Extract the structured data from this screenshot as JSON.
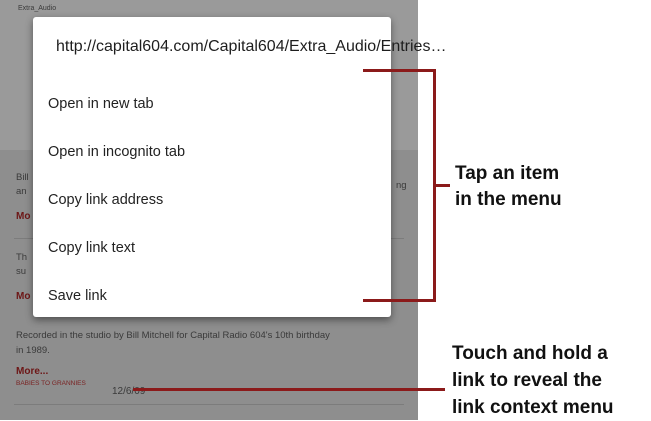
{
  "background": {
    "header_snippet": "Extra_Audio",
    "date": "12/6/09",
    "lines": [
      {
        "text": "Bill"
      },
      {
        "text": "an"
      },
      {
        "text": "ng"
      },
      {
        "text": "Mo"
      },
      {
        "text": "Th"
      },
      {
        "text": "su"
      },
      {
        "text": "Mo"
      }
    ],
    "recorded_line_1": "Recorded in the studio by Bill Mitchell for Capital Radio 604's 10th birthday",
    "recorded_line_2": "in 1989.",
    "more_label": "More...",
    "category_label": "BABIES TO GRANNIES"
  },
  "context_menu": {
    "url": "http://capital604.com/Capital604/Extra_Audio/Entries…",
    "items": [
      {
        "label": "Open in new tab"
      },
      {
        "label": "Open in incognito tab"
      },
      {
        "label": "Copy link address"
      },
      {
        "label": "Copy link text"
      },
      {
        "label": "Save link"
      }
    ]
  },
  "callouts": {
    "menu_hint": {
      "line1": "Tap an item",
      "line2": "in the menu"
    },
    "hold_hint": {
      "line1": "Touch and hold a",
      "line2": "link to reveal the",
      "line3": "link context menu"
    }
  },
  "colors": {
    "callout_line": "#8b1a1a",
    "dimmed_background": "#8e8e8e",
    "menu_background": "#ffffff"
  }
}
